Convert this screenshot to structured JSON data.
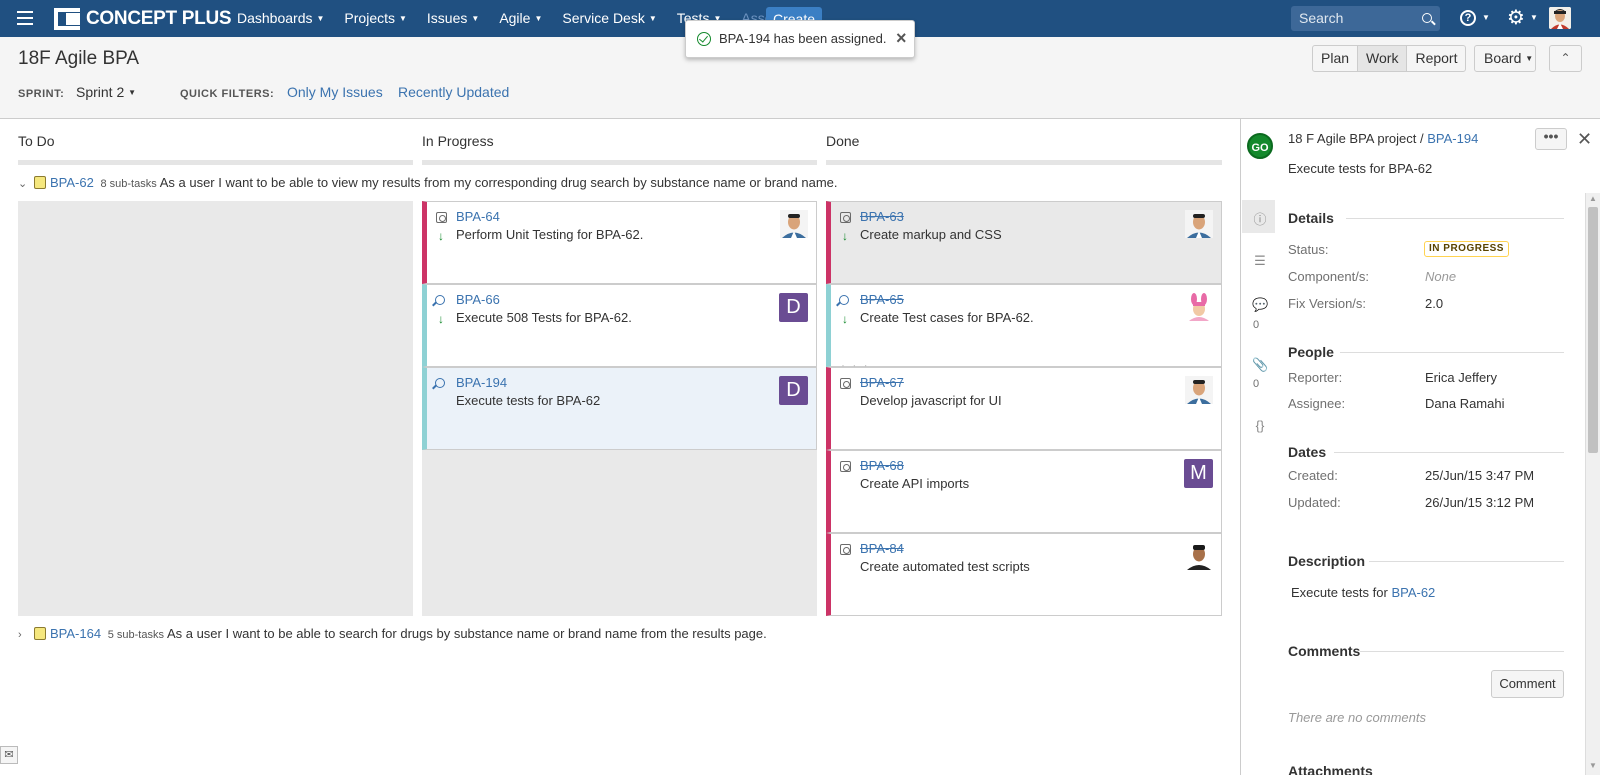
{
  "nav": {
    "logo_text": "CONCEPT PLUS",
    "items": [
      "Dashboards",
      "Projects",
      "Issues",
      "Agile",
      "Service Desk",
      "Tests",
      "Assets"
    ],
    "create_label": "Create",
    "search_placeholder": "Search"
  },
  "flag": {
    "message": "BPA-194 has been assigned."
  },
  "header": {
    "title": "18F Agile BPA",
    "sprint_label": "SPRINT:",
    "sprint_value": "Sprint 2",
    "quick_filters_label": "QUICK FILTERS:",
    "quick_filters": [
      "Only My Issues",
      "Recently Updated"
    ],
    "modes": [
      "Plan",
      "Work",
      "Report"
    ],
    "active_mode": "Work",
    "board_label": "Board"
  },
  "columns": [
    "To Do",
    "In Progress",
    "Done"
  ],
  "swimlanes": [
    {
      "key": "BPA-62",
      "subtasks": "8 sub-tasks",
      "summary": "As a user I want to be able to view my results from my corresponding drug search by substance name or brand name.",
      "expanded": true
    },
    {
      "key": "BPA-164",
      "subtasks": "5 sub-tasks",
      "summary": "As a user I want to be able to search for drugs by substance name or brand name from the results page.",
      "expanded": false
    }
  ],
  "cards": {
    "in_progress": [
      {
        "key": "BPA-64",
        "summary": "Perform Unit Testing for BPA-62.",
        "type": "test",
        "avatar": "photo"
      },
      {
        "key": "BPA-66",
        "summary": "Execute 508 Tests for BPA-62.",
        "type": "query",
        "avatar": "D"
      },
      {
        "key": "BPA-194",
        "summary": "Execute tests for BPA-62",
        "type": "query",
        "avatar": "D"
      }
    ],
    "done": [
      {
        "key": "BPA-63",
        "summary": "Create markup and CSS",
        "type": "test",
        "avatar": "photo"
      },
      {
        "key": "BPA-65",
        "summary": "Create Test cases for BPA-62.",
        "type": "query",
        "avatar": "photo-pink"
      },
      {
        "key": "BPA-67",
        "summary": "Develop javascript for UI",
        "type": "test",
        "avatar": "photo"
      },
      {
        "key": "BPA-68",
        "summary": "Create API imports",
        "type": "test",
        "avatar": "M"
      },
      {
        "key": "BPA-84",
        "summary": "Create automated test scripts",
        "type": "test",
        "avatar": "photo-dark"
      }
    ]
  },
  "detail": {
    "badge": "GO",
    "project": "18 F Agile BPA project /",
    "key": "BPA-194",
    "title": "Execute tests for BPA-62",
    "comment_count": "0",
    "attachment_count": "0",
    "sections": {
      "details": "Details",
      "people": "People",
      "dates": "Dates",
      "description": "Description",
      "comments": "Comments",
      "attachments": "Attachments"
    },
    "status_label": "Status:",
    "status_value": "IN PROGRESS",
    "components_label": "Component/s:",
    "components_value": "None",
    "fix_label": "Fix Version/s:",
    "fix_value": "2.0",
    "reporter_label": "Reporter:",
    "reporter_value": "Erica Jeffery",
    "assignee_label": "Assignee:",
    "assignee_value": "Dana Ramahi",
    "created_label": "Created:",
    "created_value": "25/Jun/15 3:47 PM",
    "updated_label": "Updated:",
    "updated_value": "26/Jun/15 3:12 PM",
    "description_text": "Execute tests for ",
    "description_link": "BPA-62",
    "comment_button": "Comment",
    "no_comments": "There are no comments"
  },
  "colors": {
    "nav_bg": "#205081",
    "link": "#3b73af",
    "status_border": "#ffd351",
    "card_flag": "#cc3366",
    "card_flag_alt": "#8ed1d4"
  }
}
